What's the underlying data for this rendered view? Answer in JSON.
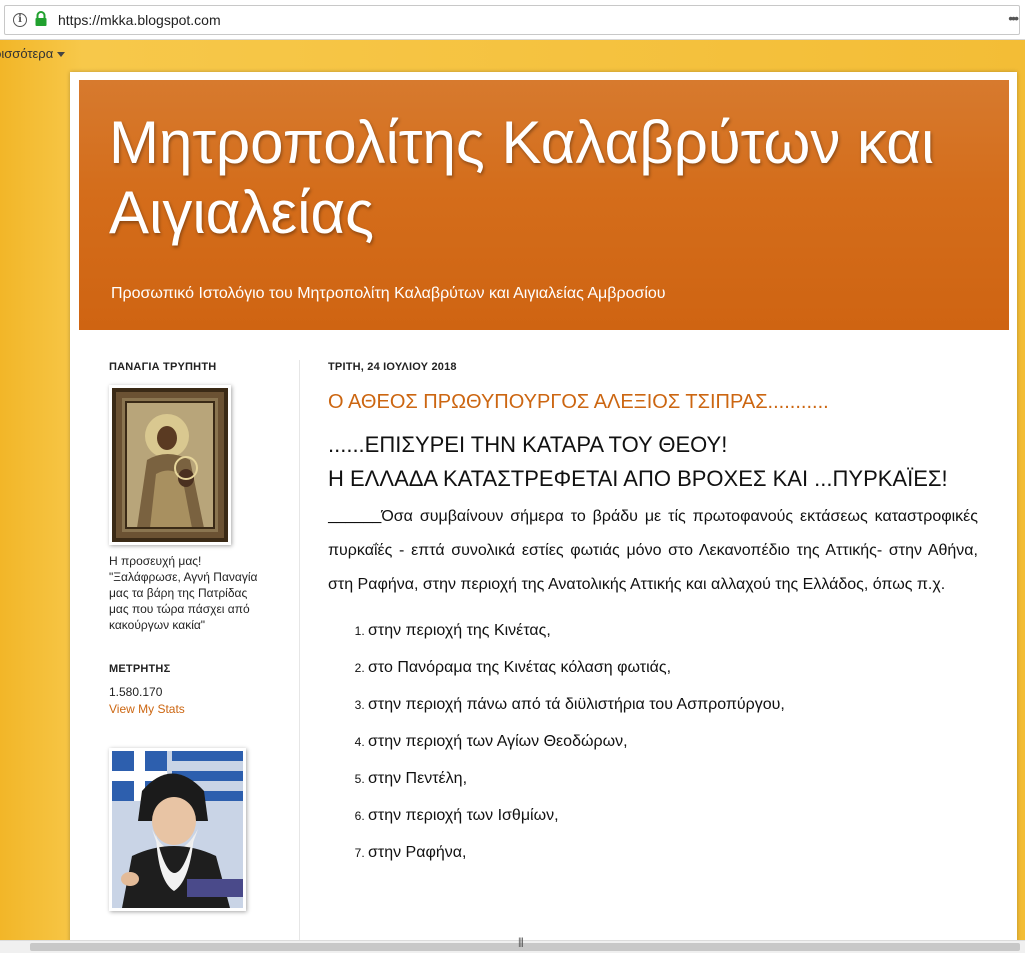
{
  "browser": {
    "url": "https://mkka.blogspot.com",
    "menu_glyph": "•••"
  },
  "navbar": {
    "more_label": "ρισσότερα"
  },
  "header": {
    "title": "Μητροπολίτης Καλαβρύτων και Αιγιαλείας",
    "description": "Προσωπικό Ιστολόγιο του Μητροπολίτη Καλαβρύτων και Αιγιαλείας Αμβροσίου"
  },
  "sidebar": {
    "icon_widget": {
      "title": "ΠΑΝΑΓΙΑ ΤΡΥΠΗΤΗ",
      "caption": "Η προσευχή μας! \"Ξαλάφρωσε, Αγνή Παναγία μας τα βάρη της Πατρίδας μας που τώρα πάσχει από κακούργων κακία\""
    },
    "counter_widget": {
      "title": "ΜΕΤΡΗΤΗΣ",
      "value": "1.580.170",
      "link": "View My Stats"
    }
  },
  "post": {
    "date": "ΤΡΙΤΗ, 24 ΙΟΥΛΙΟΥ 2018",
    "title": "Ο ΑΘΕΟΣ ΠΡΩΘΥΠΟΥΡΓΟΣ ΑΛΕΞΙΟΣ ΤΣΙΠΡΑΣ...........",
    "sub_line1": "......ΕΠΙΣΥΡΕΙ ΤΗΝ ΚΑΤΑΡΑ ΤΟΥ ΘΕΟΥ!",
    "sub_line2": "Η ΕΛΛΑΔΑ ΚΑΤΑΣΤΡΕΦΕΤΑΙ ΑΠΟ ΒΡΟΧΕΣ ΚΑΙ ...ΠΥΡΚΑΪΕΣ!",
    "body_dash": "______",
    "body_text": "Όσα συμβαίνουν σήμερα το βράδυ με τίς πρωτοφανούς εκτάσεως καταστροφικές πυρκαΐές - επτά συνολικά εστίες φωτιάς μόνο στο Λεκανοπέδιο της Αττικής- στην Αθήνα, στη Ραφήνα, στην περιοχή της Ανατολικής Αττικής και αλλαχού της Ελλάδος, όπως π.χ.",
    "places": [
      "στην περιοχή της Κινέτας,",
      "στο Πανόραμα της Κινέτας κόλαση φωτιάς,",
      "στην περιοχή πάνω από τά διϋλιστήρια του Ασπροπύργου,",
      "στην περιοχή των Αγίων Θεοδώρων,",
      "στην Πεντέλη,",
      "στην περιοχή των Ισθμίων,",
      "στην Ραφήνα,"
    ]
  },
  "colors": {
    "header_orange": "#d46d1b",
    "link_orange": "#cc6611",
    "page_background": "#f3bd36"
  }
}
